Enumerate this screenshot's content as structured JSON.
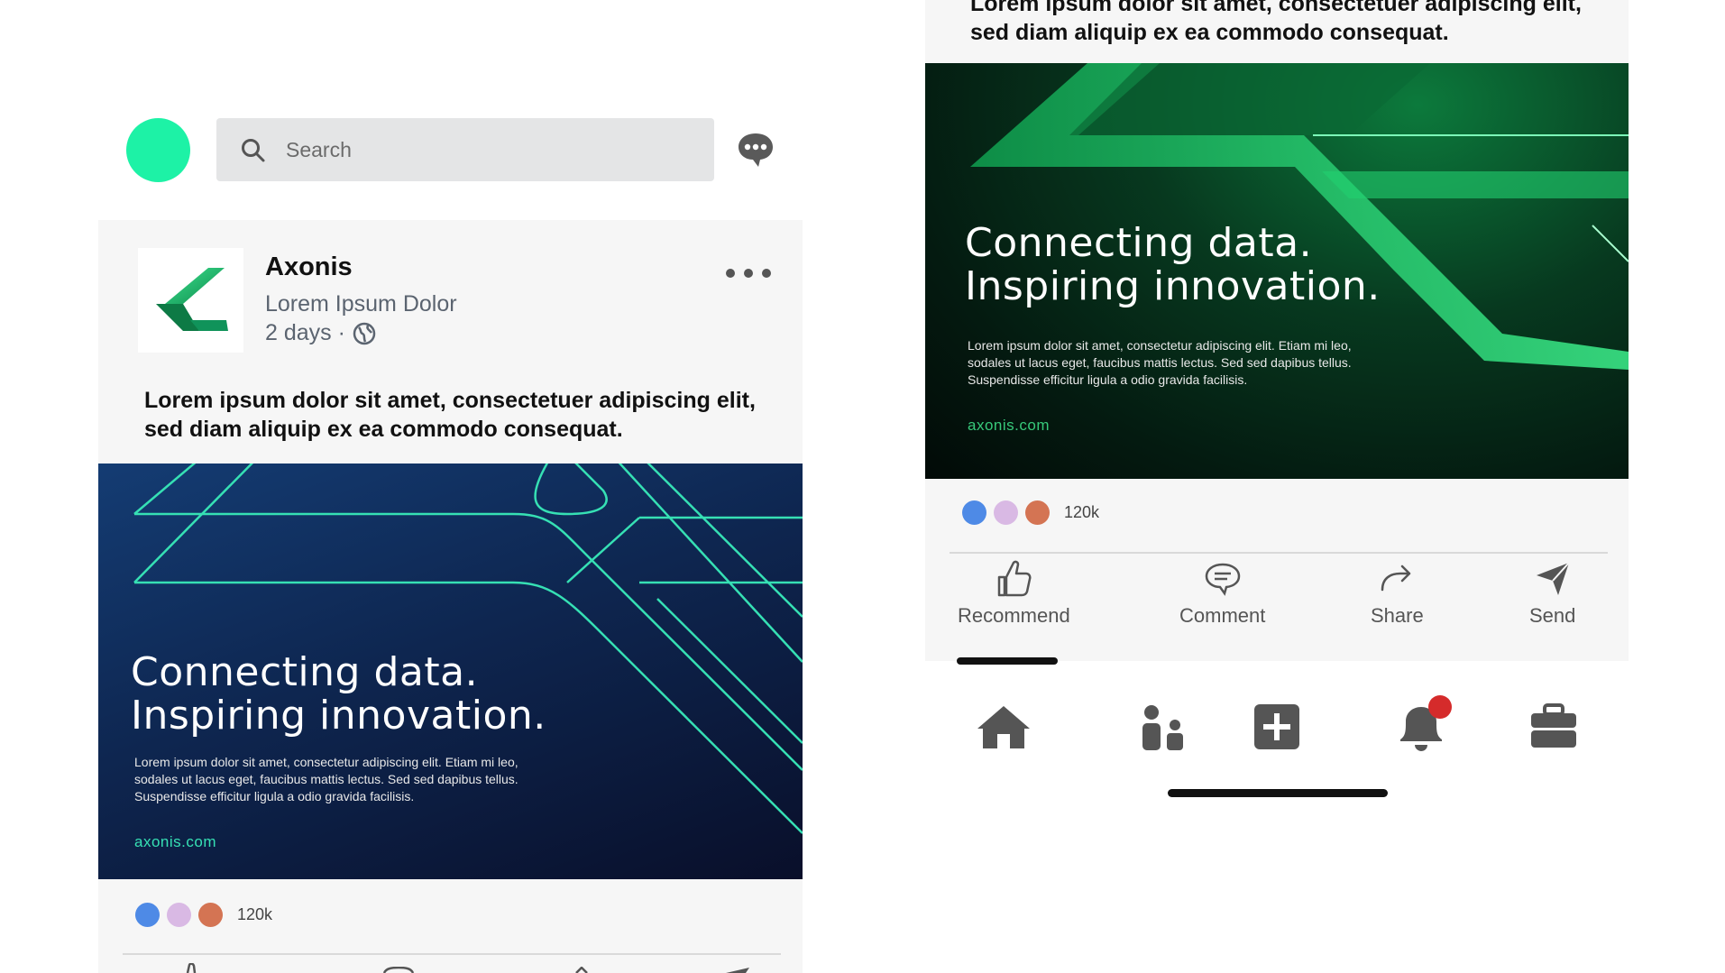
{
  "colors": {
    "accent": "#1df2a6",
    "react_blue": "#4e8ae6",
    "react_lilac": "#d9b9e4",
    "react_orange": "#d47453",
    "line_teal": "#36e0b4",
    "green_url": "#37c97a",
    "notif_red": "#d52b2b"
  },
  "header": {
    "search": {
      "placeholder": "Search",
      "icon": "search-icon"
    },
    "messages_icon": "chat-bubble-icon"
  },
  "post": {
    "company": "Axonis",
    "subtitle": "Lorem Ipsum Dolor",
    "time": "2 days ·",
    "visibility_icon": "globe-icon",
    "more_icon": "more-dots-icon",
    "text_line1": "Lorem ipsum dolor sit amet, consectetuer adipiscing elit,",
    "text_line2": "sed diam aliquip ex ea commodo consequat.",
    "banner": {
      "headline_1": "Connecting data.",
      "headline_2": "Inspiring innovation.",
      "body_1": "Lorem ipsum dolor sit amet, consectetur adipiscing elit. Etiam mi leo,",
      "body_2": "sodales ut lacus eget, faucibus mattis lectus. Sed sed dapibus tellus.",
      "body_3": "Suspendisse efficitur ligula a odio gravida facilisis.",
      "url": "axonis.com"
    },
    "reactions_count": "120k",
    "actions": [
      {
        "label": "Recommend",
        "icon": "thumbs-up-icon"
      },
      {
        "label": "Comment",
        "icon": "comment-icon"
      },
      {
        "label": "Share",
        "icon": "share-arrow-icon"
      },
      {
        "label": "Send",
        "icon": "paper-plane-icon"
      }
    ]
  },
  "bottom_nav": [
    {
      "icon": "home-icon"
    },
    {
      "icon": "people-icon"
    },
    {
      "icon": "add-post-icon"
    },
    {
      "icon": "bell-icon"
    },
    {
      "icon": "briefcase-icon"
    }
  ]
}
